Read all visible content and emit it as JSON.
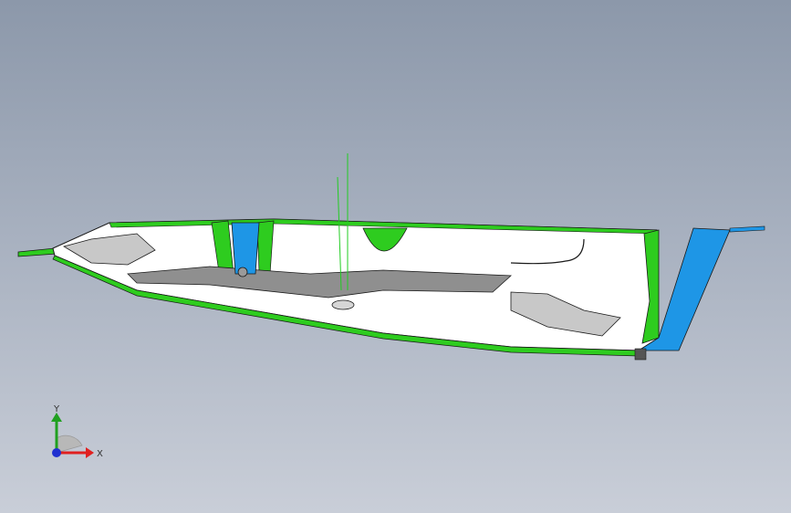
{
  "viewport": {
    "background_top": "#8c98aa",
    "background_bottom": "#c9ced8"
  },
  "model": {
    "colors": {
      "body": "#ffffff",
      "edge": "#1a1a1a",
      "green_part": "#2ecc1f",
      "dark_green": "#1f8f16",
      "blue_part": "#1e96e6",
      "gray_panel": "#8f8f8f",
      "light_gray": "#c8c8c8",
      "sketch_line": "#22cc22"
    }
  },
  "triad": {
    "y_label": "Y",
    "x_label": "X",
    "colors": {
      "x": "#e02020",
      "y": "#20a020",
      "z": "#2030d0"
    }
  }
}
